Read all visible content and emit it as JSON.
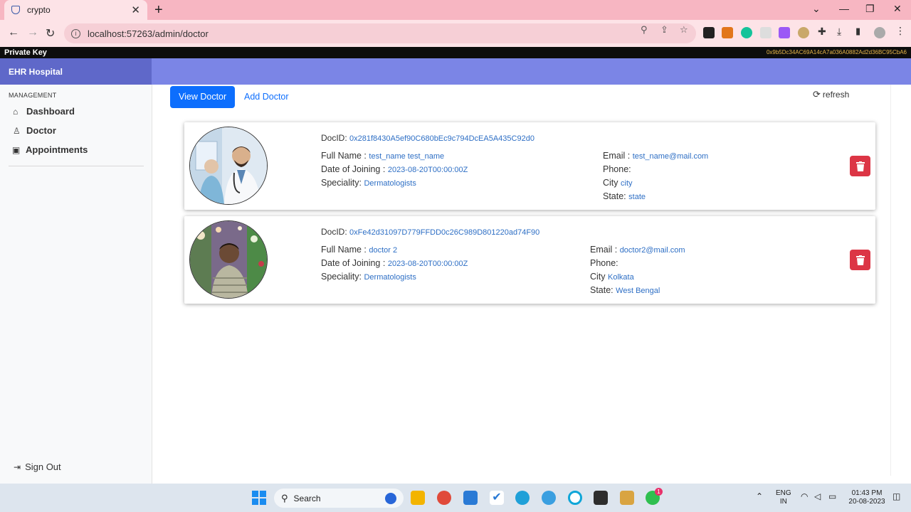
{
  "browser": {
    "tab_title": "crypto",
    "url": "localhost:57263/admin/doctor"
  },
  "app": {
    "private_key_label": "Private Key",
    "private_key_value": "0x9b5Dc34AC69A14cA7a036A0882Ad2d36BC95CbA6",
    "brand": "EHR Hospital"
  },
  "sidebar": {
    "section_label": "MANAGEMENT",
    "items": [
      {
        "label": "Dashboard",
        "icon": "home-icon"
      },
      {
        "label": "Doctor",
        "icon": "user-icon"
      },
      {
        "label": "Appointments",
        "icon": "clipboard-icon"
      }
    ],
    "signout_label": "Sign Out"
  },
  "main": {
    "tabs": [
      {
        "label": "View Doctor",
        "active": true
      },
      {
        "label": "Add Doctor",
        "active": false
      }
    ],
    "refresh_label": "refresh",
    "labels": {
      "docid": "DocID:",
      "full_name": "Full Name :",
      "doj": "Date of Joining :",
      "speciality": "Speciality:",
      "email": "Email :",
      "phone": "Phone:",
      "city": "City",
      "state": "State:"
    },
    "doctors": [
      {
        "docid": "0x281f8430A5ef90C680bEc9c794DcEA5A435C92d0",
        "full_name": "test_name test_name",
        "doj": "2023-08-20T00:00:00Z",
        "speciality": "Dermatologists",
        "email": "test_name@mail.com",
        "phone": "",
        "city": "city",
        "state": "state"
      },
      {
        "docid": "0xFe42d31097D779FFDD0c26C989D801220ad74F90",
        "full_name": "doctor 2",
        "doj": "2023-08-20T00:00:00Z",
        "speciality": "Dermatologists",
        "email": "doctor2@mail.com",
        "phone": "",
        "city": "Kolkata",
        "state": "West Bengal"
      }
    ]
  },
  "taskbar": {
    "search_label": "Search",
    "lang": "ENG",
    "region": "IN",
    "time": "01:43 PM",
    "date": "20-08-2023",
    "whatsapp_badge": "1"
  }
}
